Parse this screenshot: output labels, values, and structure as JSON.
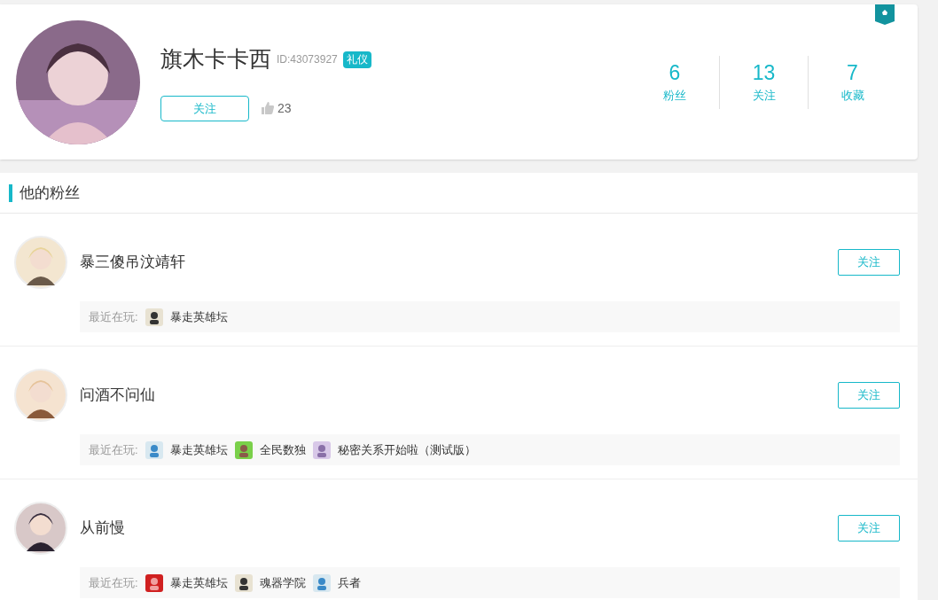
{
  "profile": {
    "name": "旗木卡卡西",
    "id": "ID:43073927",
    "badge": "礼仪",
    "follow_button": "关注",
    "likes": "23"
  },
  "stats": [
    {
      "value": "6",
      "label": "粉丝"
    },
    {
      "value": "13",
      "label": "关注"
    },
    {
      "value": "7",
      "label": "收藏"
    }
  ],
  "section": {
    "title": "他的粉丝"
  },
  "fans": [
    {
      "name": "暴三傻吊汶靖轩",
      "follow_button": "关注",
      "recent_label": "最近在玩:",
      "games": [
        "暴走英雄坛"
      ]
    },
    {
      "name": "问酒不问仙",
      "follow_button": "关注",
      "recent_label": "最近在玩:",
      "games": [
        "暴走英雄坛",
        "全民数独",
        "秘密关系开始啦（测试版）"
      ]
    },
    {
      "name": "从前慢",
      "follow_button": "关注",
      "recent_label": "最近在玩:",
      "games": [
        "暴走英雄坛",
        "魂器学院",
        "兵者"
      ]
    }
  ]
}
